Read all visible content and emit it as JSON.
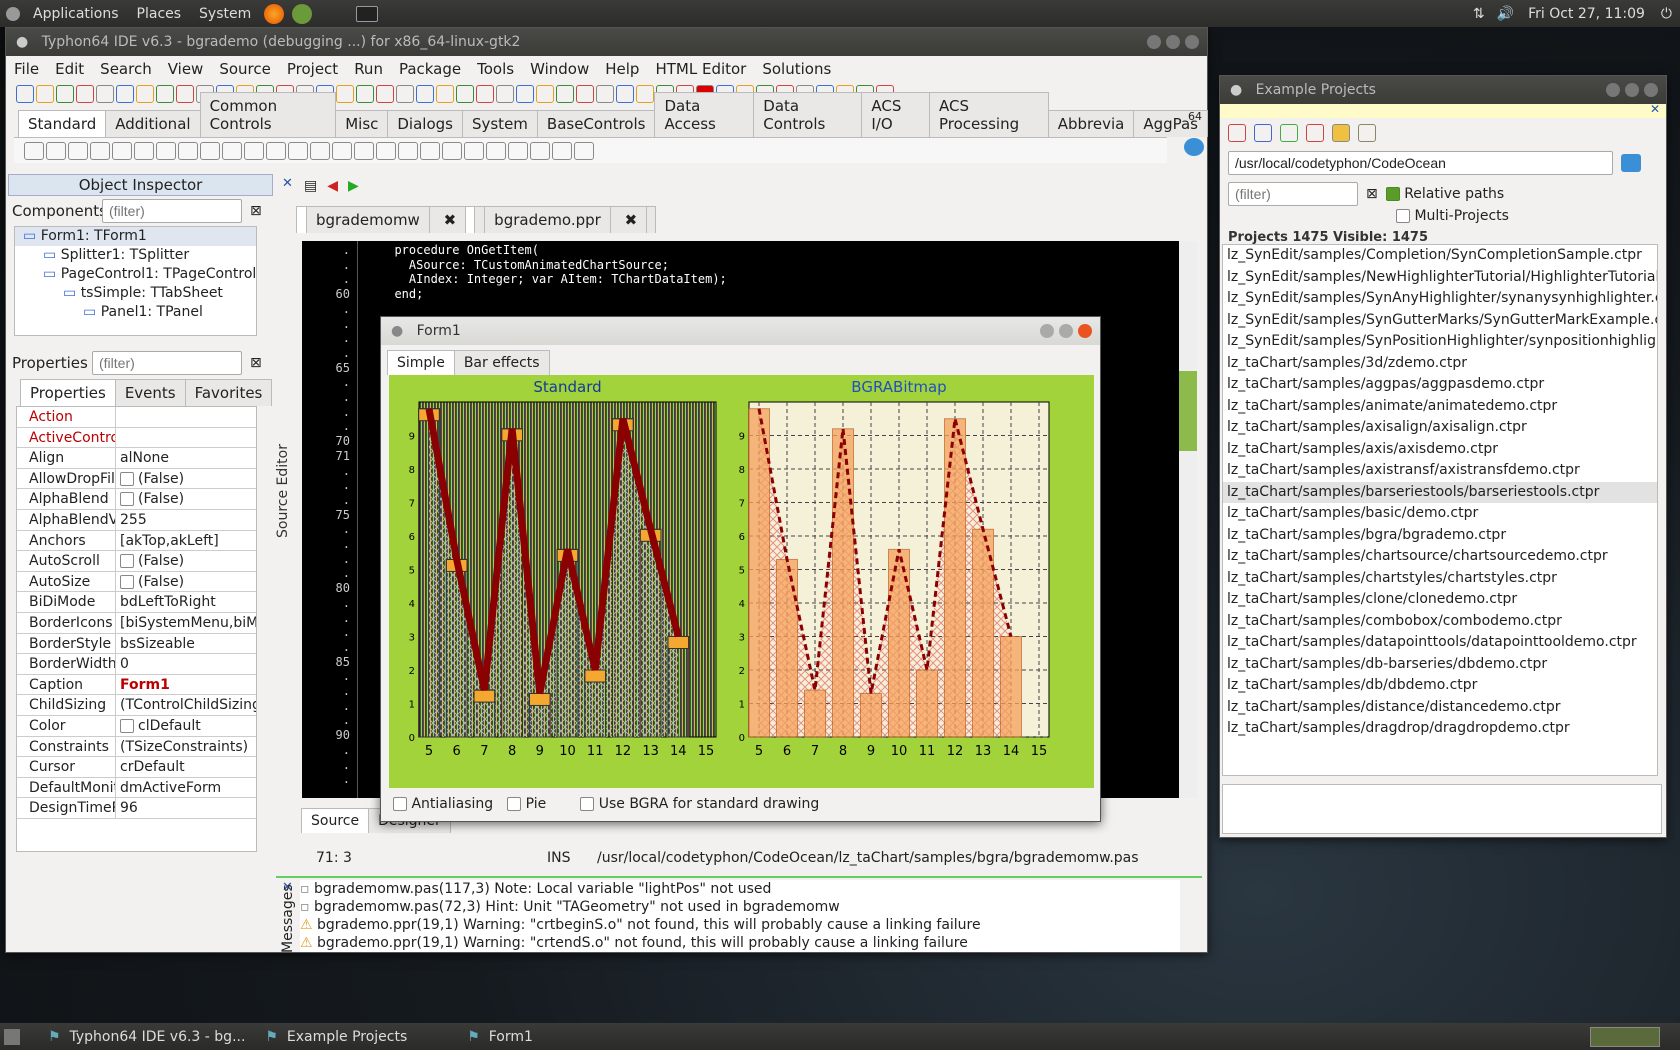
{
  "topbar": {
    "menus": [
      "Applications",
      "Places",
      "System"
    ],
    "clock": "Fri Oct 27, 11:09"
  },
  "ide": {
    "title": "Typhon64 IDE v6.3 - bgrademo (debugging ...) for x86_64-linux-gtk2",
    "menus": [
      "File",
      "Edit",
      "Search",
      "View",
      "Source",
      "Project",
      "Run",
      "Package",
      "Tools",
      "Window",
      "Help",
      "HTML Editor",
      "Solutions"
    ],
    "palette_tabs": [
      "Standard",
      "Additional",
      "Common Controls",
      "Misc",
      "Dialogs",
      "System",
      "BaseControls",
      "Data Access",
      "Data Controls",
      "ACS I/O",
      "ACS Processing",
      "Abbrevia",
      "AggPas"
    ],
    "palette_badge": "64"
  },
  "inspector": {
    "title": "Object Inspector",
    "components_label": "Components",
    "filter_placeholder": "(filter)",
    "tree": [
      "Form1: TForm1",
      "Splitter1: TSplitter",
      "PageControl1: TPageControl",
      "tsSimple: TTabSheet",
      "Panel1: TPanel"
    ],
    "properties_label": "Properties",
    "tabs": [
      "Properties",
      "Events",
      "Favorites"
    ],
    "props": [
      {
        "n": "Action",
        "v": ""
      },
      {
        "n": "ActiveControl",
        "v": ""
      },
      {
        "n": "Align",
        "v": "alNone"
      },
      {
        "n": "AllowDropFiles",
        "v": "(False)"
      },
      {
        "n": "AlphaBlend",
        "v": "(False)"
      },
      {
        "n": "AlphaBlendValue",
        "v": "255"
      },
      {
        "n": "Anchors",
        "v": "[akTop,akLeft]"
      },
      {
        "n": "AutoScroll",
        "v": "(False)"
      },
      {
        "n": "AutoSize",
        "v": "(False)"
      },
      {
        "n": "BiDiMode",
        "v": "bdLeftToRight"
      },
      {
        "n": "BorderIcons",
        "v": "[biSystemMenu,biMinimize]"
      },
      {
        "n": "BorderStyle",
        "v": "bsSizeable"
      },
      {
        "n": "BorderWidth",
        "v": "0"
      },
      {
        "n": "Caption",
        "v": "Form1"
      },
      {
        "n": "ChildSizing",
        "v": "(TControlChildSizing)"
      },
      {
        "n": "Color",
        "v": "clDefault"
      },
      {
        "n": "Constraints",
        "v": "(TSizeConstraints)"
      },
      {
        "n": "Cursor",
        "v": "crDefault"
      },
      {
        "n": "DefaultMonitor",
        "v": "dmActiveForm"
      },
      {
        "n": "DesignTimePPI",
        "v": "96"
      }
    ]
  },
  "editor": {
    "tabs": [
      "bgrademomw",
      "bgrademo.ppr"
    ],
    "side_label": "Source Editor",
    "lines": [
      {
        "n": "",
        "t": "  procedure OnGetItem("
      },
      {
        "n": "",
        "t": "    ASource: TCustomAnimatedChartSource;"
      },
      {
        "n": "",
        "t": "    AIndex: Integer; var AItem: TChartDataItem);"
      },
      {
        "n": "60",
        "t": "  end;"
      },
      {
        "n": "",
        "t": ""
      },
      {
        "n": "",
        "t": "var"
      },
      {
        "n": "",
        "t": "  Fo"
      },
      {
        "n": "",
        "t": ""
      },
      {
        "n": "65",
        "t": "impl"
      },
      {
        "n": "",
        "t": ""
      },
      {
        "n": "",
        "t": "{$R"
      },
      {
        "n": "",
        "t": ""
      },
      {
        "n": "",
        "t": "uses"
      },
      {
        "n": "70",
        "t": "  Ma"
      },
      {
        "n": "71",
        "t": "  TA"
      },
      {
        "n": "",
        "t": "  TA"
      },
      {
        "n": "",
        "t": ""
      },
      {
        "n": "",
        "t": "{ T"
      },
      {
        "n": "75",
        "t": ""
      },
      {
        "n": "",
        "t": "proc"
      },
      {
        "n": "",
        "t": "begi"
      },
      {
        "n": "",
        "t": "  if"
      },
      {
        "n": "",
        "t": ""
      },
      {
        "n": "80",
        "t": "  el"
      },
      {
        "n": "",
        "t": ""
      },
      {
        "n": "",
        "t": "end;"
      },
      {
        "n": "",
        "t": ""
      },
      {
        "n": "",
        "t": "proc"
      },
      {
        "n": "85",
        "t": "begi"
      },
      {
        "n": "",
        "t": "  if"
      },
      {
        "n": "",
        "t": ""
      },
      {
        "n": "",
        "t": "  el"
      },
      {
        "n": "",
        "t": ""
      },
      {
        "n": "90",
        "t": "end;"
      },
      {
        "n": "",
        "t": ""
      },
      {
        "n": "",
        "t": "proc"
      },
      {
        "n": "",
        "t": "begi"
      }
    ],
    "bottom_tabs": [
      "Source",
      "Designer"
    ],
    "status": {
      "pos": "71:  3",
      "mode": "INS",
      "path": "/usr/local/codetyphon/CodeOcean/lz_taChart/samples/bgra/bgrademomw.pas"
    }
  },
  "messages": {
    "label": "Messages",
    "items": [
      "bgrademomw.pas(117,3) Note: Local variable \"lightPos\" not used",
      "bgrademomw.pas(72,3) Hint: Unit \"TAGeometry\" not used in bgrademomw",
      "bgrademo.ppr(19,1) Warning: \"crtbeginS.o\" not found, this will probably cause a linking failure",
      "bgrademo.ppr(19,1) Warning: \"crtendS.o\" not found, this will probably cause a linking failure"
    ]
  },
  "form1": {
    "title": "Form1",
    "tabs": [
      "Simple",
      "Bar effects"
    ],
    "options": [
      "Antialiasing",
      "Pie",
      "Use BGRA for standard drawing"
    ]
  },
  "chart_data": [
    {
      "type": "bar",
      "title": "Standard",
      "x": [
        5,
        6,
        7,
        8,
        9,
        10,
        11,
        12,
        13,
        14,
        15
      ],
      "bars": [
        9.8,
        5.3,
        1.4,
        9.2,
        1.3,
        5.6,
        2.0,
        9.5,
        6.2,
        3.0
      ],
      "line": [
        9.8,
        5.3,
        1.4,
        9.2,
        1.3,
        5.6,
        2.0,
        9.5,
        6.2,
        3.0
      ],
      "ylim": [
        0,
        10
      ],
      "yticks": [
        0,
        1,
        2,
        3,
        4,
        5,
        6,
        7,
        8,
        9
      ],
      "colors": {
        "bar": "#f5a830",
        "line": "#8b0000",
        "bg": "#222"
      }
    },
    {
      "type": "bar",
      "title": "BGRABitmap",
      "x": [
        5,
        6,
        7,
        8,
        9,
        10,
        11,
        12,
        13,
        14,
        15
      ],
      "bars": [
        9.8,
        5.3,
        1.4,
        9.2,
        1.3,
        5.6,
        2.0,
        9.5,
        6.2,
        3.0
      ],
      "line": [
        9.8,
        5.3,
        1.4,
        9.2,
        1.3,
        5.6,
        2.0,
        9.5,
        6.2,
        3.0
      ],
      "ylim": [
        0,
        10
      ],
      "yticks": [
        0,
        1,
        2,
        3,
        4,
        5,
        6,
        7,
        8,
        9
      ],
      "colors": {
        "bar": "#f5a05a",
        "line": "#8b0000",
        "bg": "#f5f0d8"
      }
    }
  ],
  "examples": {
    "title": "Example Projects",
    "path": "/usr/local/codetyphon/CodeOcean",
    "filter_placeholder": "(filter)",
    "relative_paths": "Relative paths",
    "multi_projects": "Multi-Projects",
    "count": "Projects 1475  Visible: 1475",
    "selected": 11,
    "items": [
      "lz_SynEdit/samples/Completion/SynCompletionSample.ctpr",
      "lz_SynEdit/samples/NewHighlighterTutorial/HighlighterTutorial",
      "lz_SynEdit/samples/SynAnyHighlighter/synanysynhighlighter.ctp",
      "lz_SynEdit/samples/SynGutterMarks/SynGutterMarkExample.ct",
      "lz_SynEdit/samples/SynPositionHighlighter/synpositionhighligh",
      "lz_taChart/samples/3d/zdemo.ctpr",
      "lz_taChart/samples/aggpas/aggpasdemo.ctpr",
      "lz_taChart/samples/animate/animatedemo.ctpr",
      "lz_taChart/samples/axisalign/axisalign.ctpr",
      "lz_taChart/samples/axis/axisdemo.ctpr",
      "lz_taChart/samples/axistransf/axistransfdemo.ctpr",
      "lz_taChart/samples/barseriestools/barseriestools.ctpr",
      "lz_taChart/samples/basic/demo.ctpr",
      "lz_taChart/samples/bgra/bgrademo.ctpr",
      "lz_taChart/samples/chartsource/chartsourcedemo.ctpr",
      "lz_taChart/samples/chartstyles/chartstyles.ctpr",
      "lz_taChart/samples/clone/clonedemo.ctpr",
      "lz_taChart/samples/combobox/combodemo.ctpr",
      "lz_taChart/samples/datapointtools/datapointtooldemo.ctpr",
      "lz_taChart/samples/db-barseries/dbdemo.ctpr",
      "lz_taChart/samples/db/dbdemo.ctpr",
      "lz_taChart/samples/distance/distancedemo.ctpr",
      "lz_taChart/samples/dragdrop/dragdropdemo.ctpr"
    ]
  },
  "taskbar": [
    "Typhon64 IDE v6.3 - bg...",
    "Example Projects",
    "Form1"
  ]
}
